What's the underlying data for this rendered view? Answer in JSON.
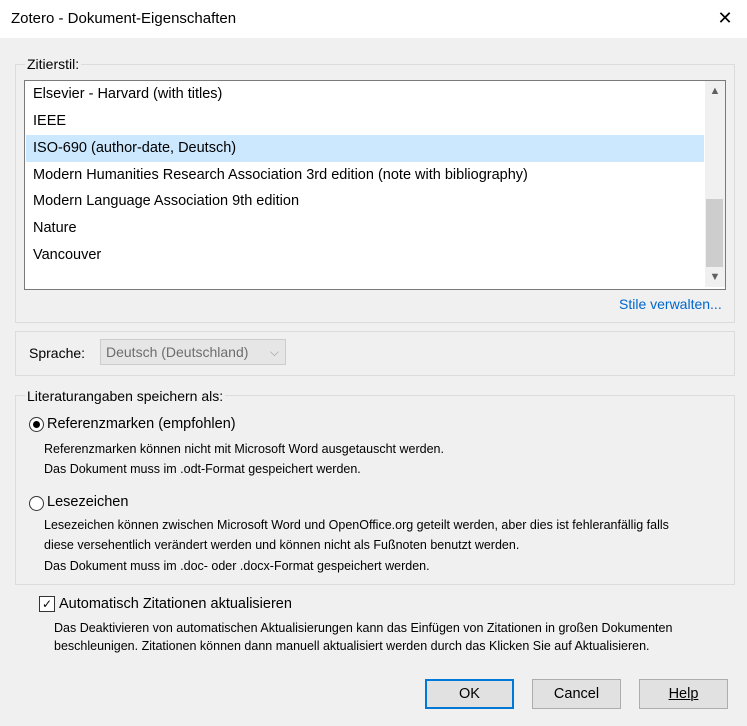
{
  "window": {
    "title": "Zotero - Dokument-Eigenschaften",
    "close_icon": "✕"
  },
  "citation_style": {
    "label": "Zitierstil:",
    "items": [
      "Elsevier - Harvard (with titles)",
      "IEEE",
      "ISO-690 (author-date, Deutsch)",
      "Modern Humanities Research Association 3rd edition (note with bibliography)",
      "Modern Language Association 9th edition",
      "Nature",
      "Vancouver"
    ],
    "selected": "ISO-690 (author-date, Deutsch)",
    "manage_link": "Stile verwalten..."
  },
  "language": {
    "label": "Sprache:",
    "value": "Deutsch (Deutschland)",
    "arrow": "⌵"
  },
  "storage": {
    "label": "Literaturangaben speichern als:",
    "option1": {
      "label": "Referenzmarken (empfohlen)",
      "desc1": "Referenzmarken können nicht mit Microsoft Word ausgetauscht werden.",
      "desc2": "Das Dokument muss im .odt-Format gespeichert werden.",
      "checked": true
    },
    "option2": {
      "label": "Lesezeichen",
      "desc1": "Lesezeichen können zwischen Microsoft Word und OpenOffice.org geteilt werden, aber dies ist fehleranfällig falls",
      "desc2": "diese versehentlich verändert werden und können nicht als Fußnoten benutzt werden.",
      "desc3": "Das Dokument muss im .doc- oder .docx-Format gespeichert werden.",
      "checked": false
    }
  },
  "auto_update": {
    "label": "Automatisch Zitationen aktualisieren",
    "checked": true,
    "check_mark": "✓",
    "desc1": "Das Deaktivieren von automatischen Aktualisierungen kann das Einfügen von Zitationen in großen Dokumenten",
    "desc2": "beschleunigen. Zitationen können dann manuell aktualisiert werden durch das Klicken Sie auf Aktualisieren."
  },
  "buttons": {
    "ok": "OK",
    "cancel": "Cancel",
    "help": "Help"
  },
  "scroll": {
    "up": "▲",
    "down": "▼"
  }
}
